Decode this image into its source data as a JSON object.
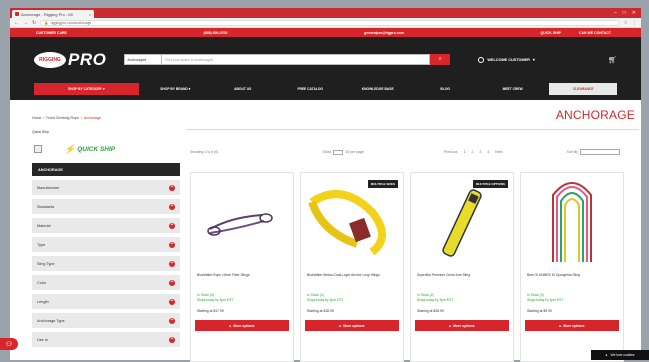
{
  "browser": {
    "tab_title": "Anchorage - Rigging Pro - Mi",
    "tab_close": "x",
    "window_controls": [
      "–",
      "□",
      "✕"
    ],
    "url": "riggingpro.com/anchorage"
  },
  "topstrip": {
    "left": "CUSTOMER CARE",
    "phone": "(888) 000-0700",
    "email": "generalpro@rigpro.com",
    "quick_ship": "QUICK SHIP",
    "our_contact": "CAN WE CONTACT"
  },
  "header": {
    "logo_badge": "RIGGING",
    "logo_text": "PRO",
    "search_category": "Anchorage",
    "search_placeholder": "Find your spare to Anchorages",
    "welcome": "WELCOME CUSTOMER"
  },
  "nav": {
    "shop": "SHOP BY CATEGORY",
    "brand": "SHOP BY BRAND",
    "about": "ABOUT US",
    "catalog": "FREE CATALOG",
    "knowledge": "KNOWLEDGE BASE",
    "blog": "BLOG",
    "contact": "MEET CREW",
    "clearance": "CLEARANCE"
  },
  "breadcrumb": {
    "home": "Home",
    "sep1": "/",
    "parent": "Fixed Climbing Rope",
    "sep2": "/",
    "current": "Anchorage"
  },
  "page_title": "ANCHORAGE",
  "quick_ship": {
    "label": "Quick Ship",
    "logo_text": "QUICK SHIP"
  },
  "sidebar": {
    "heading": "ANCHORAGE",
    "filters": [
      {
        "label": "Manufacturer"
      },
      {
        "label": "Standards"
      },
      {
        "label": "Material"
      },
      {
        "label": "Type"
      },
      {
        "label": "Sling Type"
      },
      {
        "label": "Color"
      },
      {
        "label": "Length"
      },
      {
        "label": "Anchorage Type"
      },
      {
        "label": "Use In"
      }
    ]
  },
  "toolbar": {
    "results": "Showing 1 to 6 (6)",
    "show": "Show",
    "per_page": "15 per page",
    "prev": "Previous",
    "pages": [
      "1",
      "2",
      "3",
      "4"
    ],
    "next": "Next",
    "sort_label": "Sort By"
  },
  "products": [
    {
      "badge": "",
      "name": "BlueWater Rope 10mm Fiber Slings",
      "stock": "In Stock (5)",
      "ship": "Ships today by 3pm EST",
      "price": "Starting at $17.99",
      "more": "More options"
    },
    {
      "badge": "MULTIPLE SIZES",
      "name": "BlueWater Webco Dual-Layer Anchor Loop Slings",
      "stock": "In Stock (4)",
      "ship": "Ships today by 3pm EST",
      "price": "Starting at $18.99",
      "more": "More options"
    },
    {
      "badge": "MULTIPLE OPTIONS",
      "name": "SuperBar Premium Cross-Arm Sling",
      "stock": "In Stock (2)",
      "ship": "Ships today by 3pm EST",
      "price": "Starting at $28.99",
      "more": "More options"
    },
    {
      "badge": "",
      "name": "Best Of UNMEK Di Spungelna Sling",
      "stock": "In Stock (3)",
      "ship": "Ships today by 3pm EST",
      "price": "Starting at $9.99",
      "more": "More options"
    }
  ],
  "footer": {
    "cookie": "We love cookies"
  }
}
